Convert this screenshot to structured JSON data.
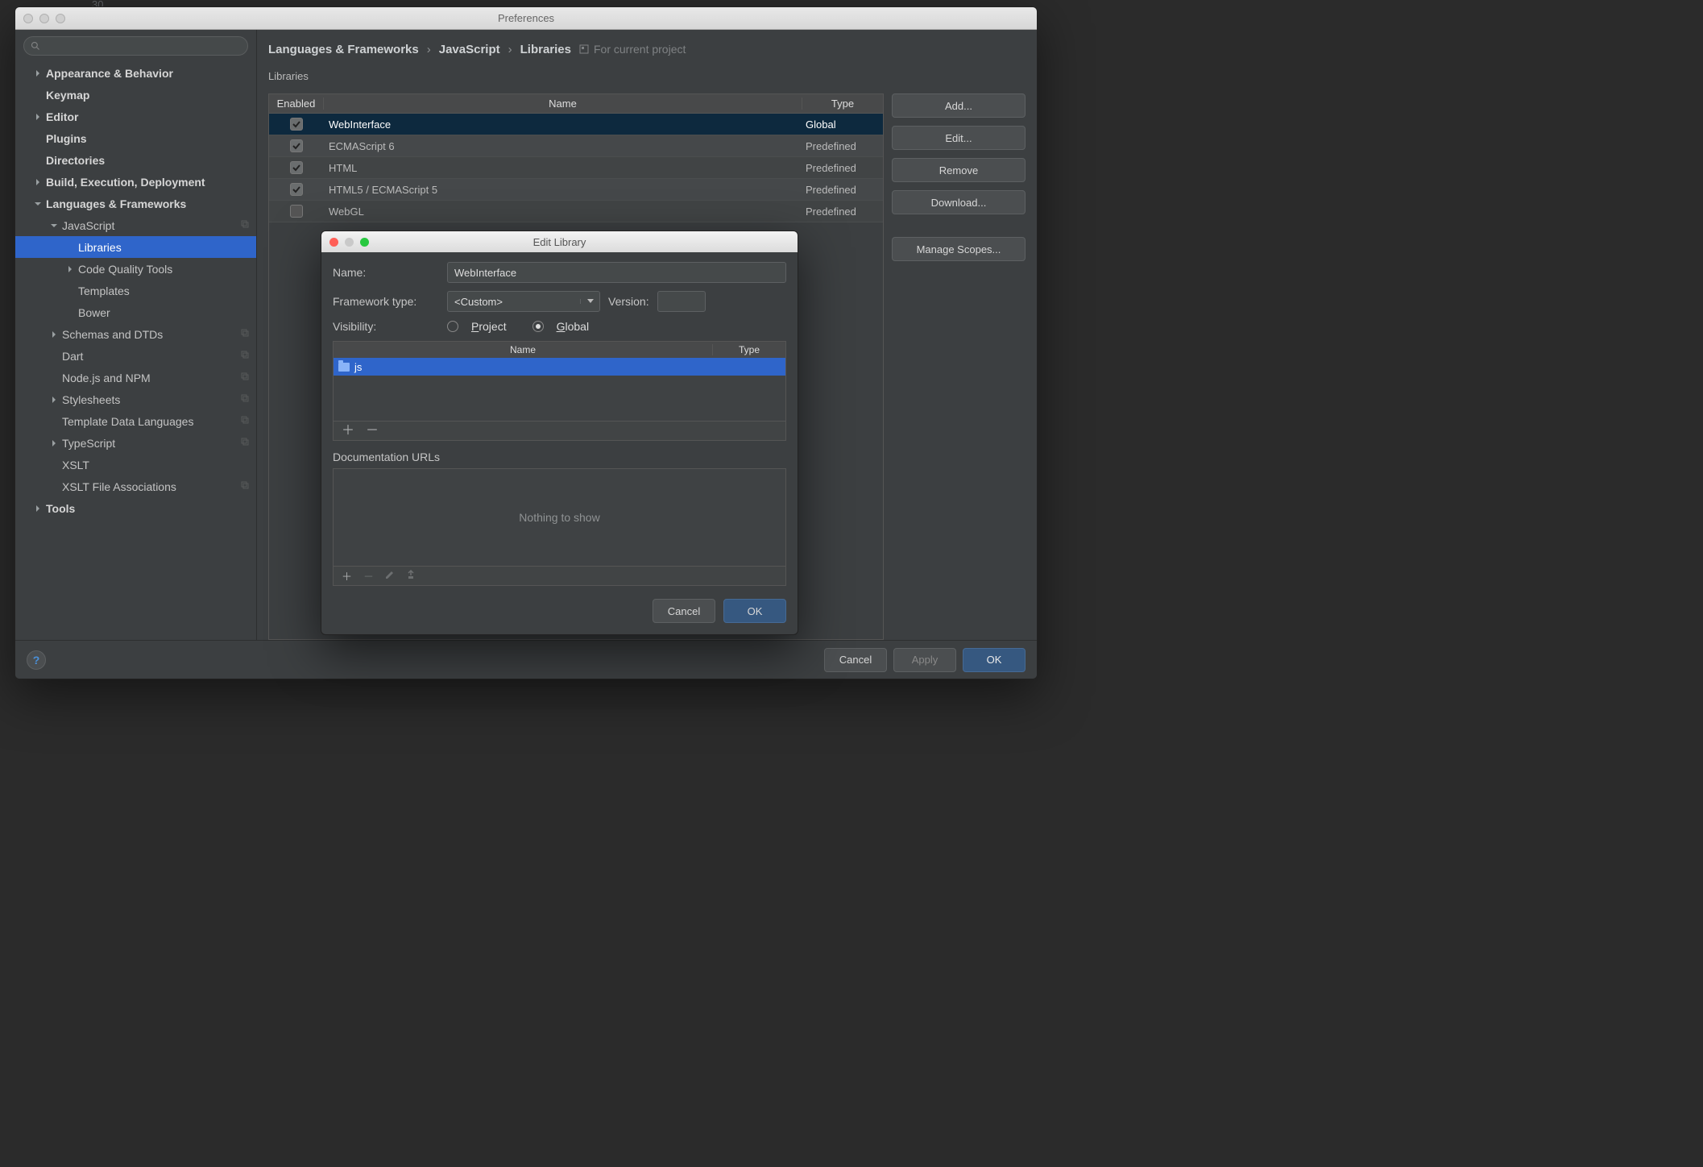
{
  "bg_linenum": "30",
  "window": {
    "title": "Preferences"
  },
  "search": {
    "placeholder": ""
  },
  "sidebar": {
    "items": [
      {
        "label": "Appearance & Behavior",
        "depth": 0,
        "arrow": "right",
        "bold": true
      },
      {
        "label": "Keymap",
        "depth": 0,
        "bold": true
      },
      {
        "label": "Editor",
        "depth": 0,
        "arrow": "right",
        "bold": true
      },
      {
        "label": "Plugins",
        "depth": 0,
        "bold": true
      },
      {
        "label": "Directories",
        "depth": 0,
        "bold": true
      },
      {
        "label": "Build, Execution, Deployment",
        "depth": 0,
        "arrow": "right",
        "bold": true
      },
      {
        "label": "Languages & Frameworks",
        "depth": 0,
        "arrow": "down",
        "bold": true
      },
      {
        "label": "JavaScript",
        "depth": 1,
        "arrow": "down",
        "copy": true
      },
      {
        "label": "Libraries",
        "depth": 2,
        "selected": true
      },
      {
        "label": "Code Quality Tools",
        "depth": 2,
        "arrow": "right"
      },
      {
        "label": "Templates",
        "depth": 2
      },
      {
        "label": "Bower",
        "depth": 2
      },
      {
        "label": "Schemas and DTDs",
        "depth": 1,
        "arrow": "right",
        "copy": true
      },
      {
        "label": "Dart",
        "depth": 1,
        "copy": true
      },
      {
        "label": "Node.js and NPM",
        "depth": 1,
        "copy": true
      },
      {
        "label": "Stylesheets",
        "depth": 1,
        "arrow": "right",
        "copy": true
      },
      {
        "label": "Template Data Languages",
        "depth": 1,
        "copy": true
      },
      {
        "label": "TypeScript",
        "depth": 1,
        "arrow": "right",
        "copy": true
      },
      {
        "label": "XSLT",
        "depth": 1
      },
      {
        "label": "XSLT File Associations",
        "depth": 1,
        "copy": true
      },
      {
        "label": "Tools",
        "depth": 0,
        "arrow": "right",
        "bold": true
      }
    ]
  },
  "breadcrumb": {
    "a": "Languages & Frameworks",
    "b": "JavaScript",
    "c": "Libraries",
    "scope": "For current project"
  },
  "libraries": {
    "caption": "Libraries",
    "header": {
      "enabled": "Enabled",
      "name": "Name",
      "type": "Type"
    },
    "rows": [
      {
        "enabled": true,
        "name": "WebInterface",
        "type": "Global",
        "selected": true
      },
      {
        "enabled": true,
        "name": "ECMAScript 6",
        "type": "Predefined"
      },
      {
        "enabled": true,
        "name": "HTML",
        "type": "Predefined"
      },
      {
        "enabled": true,
        "name": "HTML5 / ECMAScript 5",
        "type": "Predefined"
      },
      {
        "enabled": false,
        "name": "WebGL",
        "type": "Predefined"
      }
    ]
  },
  "side_buttons": {
    "add": "Add...",
    "edit": "Edit...",
    "remove": "Remove",
    "download": "Download...",
    "manage": "Manage Scopes..."
  },
  "footer": {
    "cancel": "Cancel",
    "apply": "Apply",
    "ok": "OK",
    "help": "?"
  },
  "dialog": {
    "title": "Edit Library",
    "labels": {
      "name": "Name:",
      "framework": "Framework type:",
      "version": "Version:",
      "visibility": "Visibility:",
      "project": "Project",
      "global": "Global",
      "docs": "Documentation URLs",
      "empty": "Nothing to show"
    },
    "values": {
      "name": "WebInterface",
      "framework": "<Custom>",
      "version": "",
      "visibility": "global"
    },
    "file_table": {
      "header": {
        "name": "Name",
        "type": "Type"
      },
      "rows": [
        {
          "name": "js"
        }
      ]
    },
    "footer": {
      "cancel": "Cancel",
      "ok": "OK"
    }
  }
}
